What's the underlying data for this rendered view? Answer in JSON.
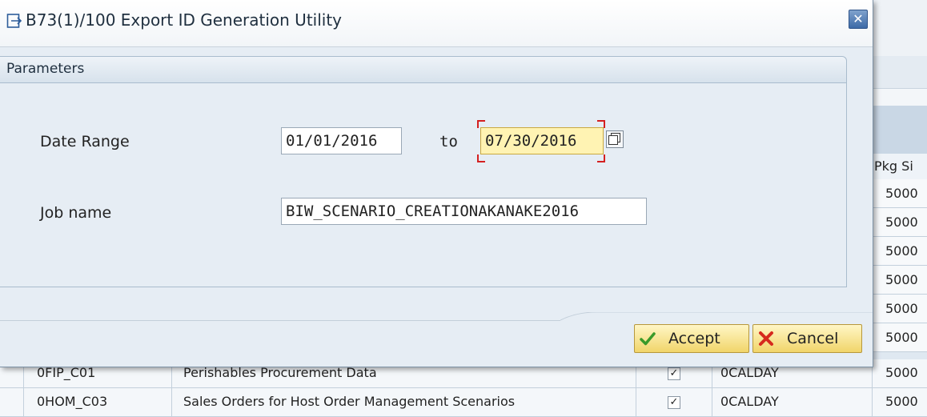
{
  "dialog": {
    "title": "B73(1)/100 Export ID Generation Utility",
    "group_title": "Parameters",
    "date_range_label": "Date Range",
    "date_from": "01/01/2016",
    "to_label": "to",
    "date_to": "07/30/2016",
    "job_name_label": "Job name",
    "job_name": "BIW_SCENARIO_CREATIONAKANAKE2016",
    "accept_label": "Accept",
    "cancel_label": "Cancel"
  },
  "background": {
    "pkg_size_header": "Pkg Si",
    "pkg_values": [
      "5000",
      "5000",
      "5000",
      "5000",
      "5000",
      "5000",
      "5000",
      "5000"
    ],
    "rows": [
      {
        "id": "0FIP_C01",
        "description": "Perishables Procurement Data",
        "checked": "✓",
        "time_char": "0CALDAY",
        "pkg": "5000"
      },
      {
        "id": "0HOM_C03",
        "description": "Sales Orders for Host Order Management Scenarios",
        "checked": "✓",
        "time_char": "0CALDAY",
        "pkg": "5000"
      }
    ]
  },
  "colors": {
    "accent": "#3d6aa7",
    "active_field": "#fff3b3",
    "button": "#f1d56a",
    "required_mark": "#d42020"
  }
}
